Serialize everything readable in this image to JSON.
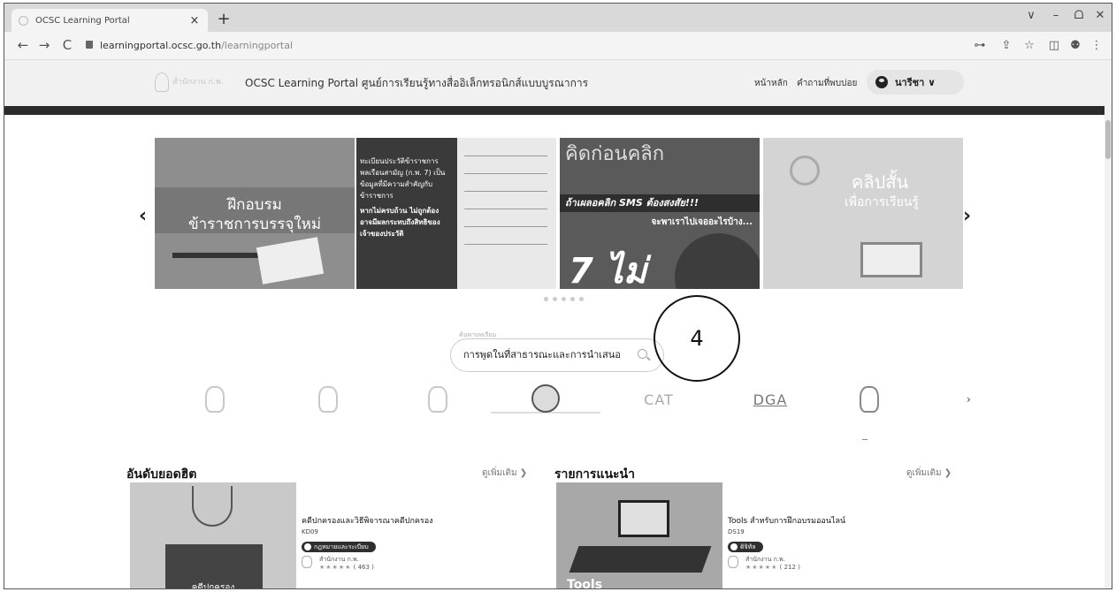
{
  "browser": {
    "tab_title": "OCSC Learning Portal",
    "tab_close": "×",
    "new_tab": "+",
    "url_host": "learningportal.ocsc.go.th",
    "url_path": "/learningportal",
    "back": "←",
    "forward": "→",
    "reload": "C",
    "win_minimize": "–",
    "win_restore": "ᗝ",
    "win_close": "✕",
    "tab_list": "∨",
    "key_icon": "⊶",
    "share_icon": "⇪",
    "star_icon": "☆",
    "sidepanel_icon": "◫",
    "profile_icon": "⚉",
    "menu_icon": "⋮"
  },
  "header": {
    "logo_text": "สำนักงาน ก.พ.",
    "site_title": "OCSC Learning Portal ศูนย์การเรียนรู้ทางสื่ออิเล็กทรอนิกส์แบบบูรณาการ",
    "nav_home": "หน้าหลัก",
    "nav_faq": "คำถามที่พบบ่อย",
    "user_name": "นารีชา ∨"
  },
  "carousel": {
    "prev": "‹",
    "next": "›",
    "banner1_line1": "ฝึกอบรม",
    "banner1_line2": "ข้าราชการบรรจุใหม่",
    "banner2_text1": "ทะเบียนประวัติข้าราชการพลเรือนสามัญ (ก.พ. 7) เป็นข้อมูลที่มีความสำคัญกับข้าราชการ",
    "banner2_text2": "หากไม่ครบถ้วน ไม่ถูกต้อง อาจมีผลกระทบถึงสิทธิของเจ้าของประวัติ",
    "banner3_head": "คิดก่อนคลิก",
    "banner3_sms": "ถ้าเผลอคลิก SMS ต้องสงสัย!!!",
    "banner3_sub": "จะพาเราไปเจออะไรบ้าง...",
    "banner3_seven": "7 ไม่",
    "banner4_line1": "คลิปสั้น",
    "banner4_line2": "เพื่อการเรียนรู้"
  },
  "search": {
    "label": "ค้นหาบทเรียน",
    "value": "การพูดในที่สาธารณะและการนำเสนอ"
  },
  "annotation": {
    "step_number": "4"
  },
  "partners": {
    "cat": "CAT",
    "dga": "DGA",
    "next": "›"
  },
  "sections": {
    "popular": {
      "title": "อันดับยอดฮิต",
      "more": "ดูเพิ่มเติม ❯",
      "course": {
        "thumb_caption": "คดีปกครอง",
        "title": "คดีปกครองและวิธีพิจารณาคดีปกครอง",
        "code": "KD09",
        "badge": "กฎหมายและระเบียบ",
        "org": "สำนักงาน ก.พ.",
        "stars": "★★★★★",
        "reviews": "( 463 )"
      }
    },
    "recommended": {
      "title": "รายการแนะนำ",
      "more": "ดูเพิ่มเติม ❯",
      "course": {
        "thumb_caption": "Tools",
        "title": "Tools สำหรับการฝึกอบรมออนไลน์",
        "code": "DS19",
        "badge": "ดิจิทัล",
        "org": "สำนักงาน ก.พ.",
        "stars": "★★★★★",
        "reviews": "( 212 )"
      }
    }
  }
}
